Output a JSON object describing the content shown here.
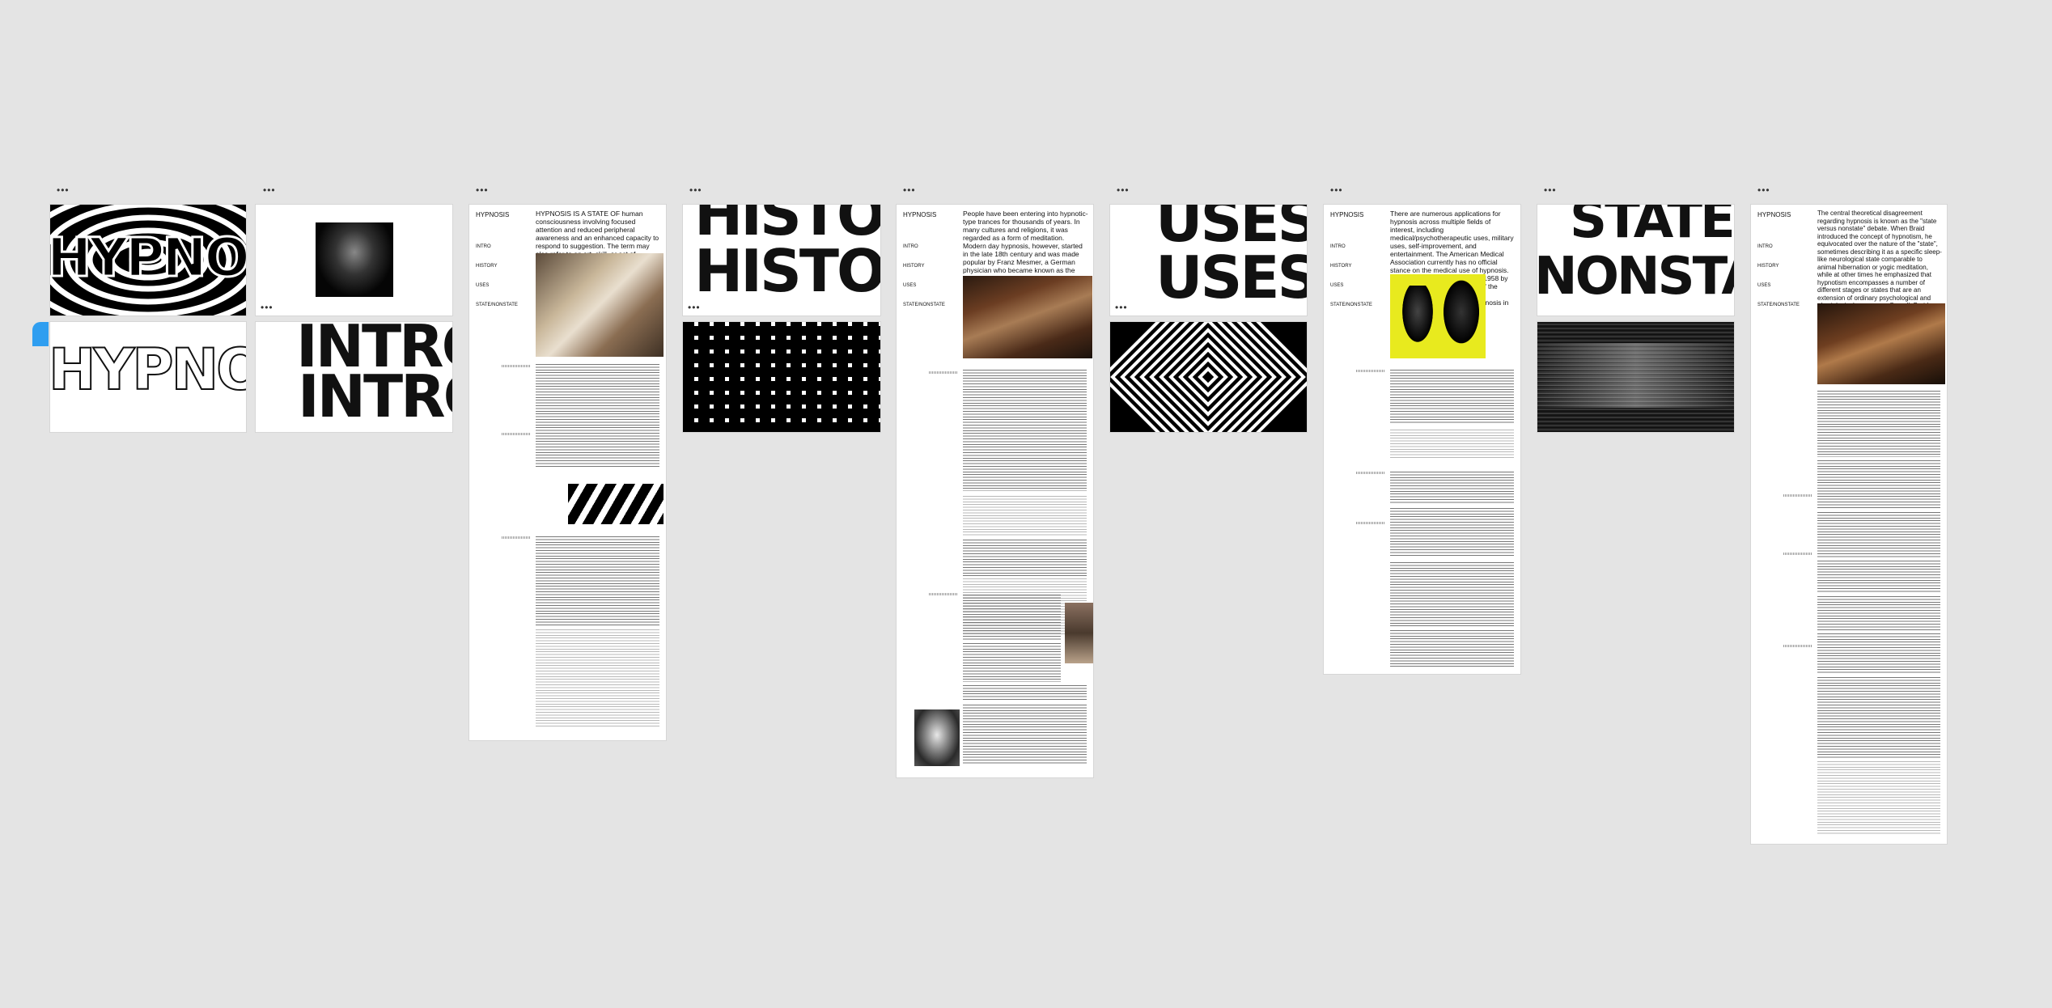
{
  "frame_menu_label": "•••",
  "covers": {
    "hypnosis": "HYPNOSIS",
    "intro": [
      "INTRO",
      "INTRO"
    ],
    "history": [
      "HISTORY",
      "HISTORY"
    ],
    "uses": [
      "USES",
      "USES"
    ],
    "state": [
      "STATE",
      "NONSTATE"
    ]
  },
  "nav": {
    "title": "HYPNOSIS",
    "items": [
      "INTRO",
      "HISTORY",
      "USES",
      "STATE/NONSTATE"
    ]
  },
  "pages": {
    "intro": {
      "lead": "HYPNOSIS IS A STATE OF human consciousness involving focused attention and reduced peripheral awareness and an enhanced capacity to respond to suggestion. The term may also refer to an art, skill, or act of inducing hypnosis."
    },
    "history": {
      "lead": "People have been entering into hypnotic-type trances for thousands of years. In many cultures and religions, it was regarded as a form of meditation. Modern day hypnosis, however, started in the late 18th century and was made popular by Franz Mesmer, a German physician who became known as the father of 'modern hypnotism'. In fact, hypnosis used to be known as 'Mesmerism' as it was named after Mesmer."
    },
    "uses": {
      "lead": "There are numerous applications for hypnosis across multiple fields of interest, including medical/psychotherapeutic uses, military uses, self-improvement, and entertainment. The American Medical Association currently has no official stance on the medical use of hypnosis. However, a study published in 1958 by the Council on Mental Health of the American Medical Association documented the efficacy of hypnosis in clinical settings."
    },
    "state": {
      "lead": "The central theoretical disagreement regarding hypnosis is known as the \"state versus nonstate\" debate. When Braid introduced the concept of hypnotism, he equivocated over the nature of the \"state\", sometimes describing it as a specific sleep-like neurological state comparable to animal hibernation or yogic meditation, while at other times he emphasized that hypnotism encompasses a number of different stages or states that are an extension of ordinary psychological and physiological processes. Overall, Braid appears to have moved from a more \"special state\" understanding of hypnotism toward a more complex \"nonstate\" orientation"
    }
  },
  "colors": {
    "canvas": "#e4e4e4",
    "selection_accent": "#2f9ef0",
    "uses_poster_yellow": "#e8ea1e"
  }
}
